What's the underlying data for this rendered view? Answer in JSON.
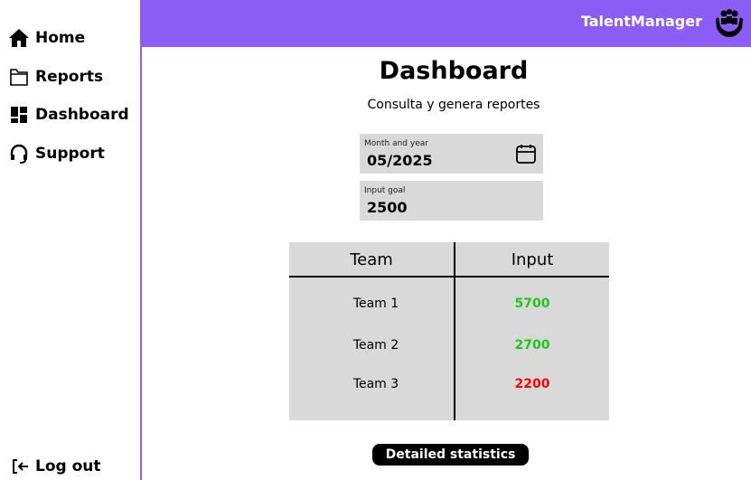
{
  "sidebar": {
    "items": [
      {
        "label": "Home",
        "icon": "home-icon"
      },
      {
        "label": "Reports",
        "icon": "folder-icon"
      },
      {
        "label": "Dashboard",
        "icon": "dashboard-icon"
      },
      {
        "label": "Support",
        "icon": "headset-icon"
      }
    ],
    "logout": {
      "label": "Log out",
      "icon": "logout-icon"
    }
  },
  "header": {
    "brand": "TalentManager",
    "logo_icon": "hands-people-icon",
    "background": "#8b5cf6"
  },
  "main": {
    "title": "Dashboard",
    "subtitle": "Consulta y genera reportes",
    "month_field": {
      "label": "Month and year",
      "value": "05/2025",
      "icon": "calendar-icon"
    },
    "goal_field": {
      "label": "Input goal",
      "value": "2500"
    },
    "table": {
      "headers": [
        "Team",
        "Input"
      ],
      "rows": [
        {
          "team": "Team 1",
          "input": "5700",
          "color": "#22c41a"
        },
        {
          "team": "Team 2",
          "input": "2700",
          "color": "#22c41a"
        },
        {
          "team": "Team 3",
          "input": "2200",
          "color": "#ff0000"
        }
      ]
    },
    "button_label": "Detailed statistics"
  }
}
